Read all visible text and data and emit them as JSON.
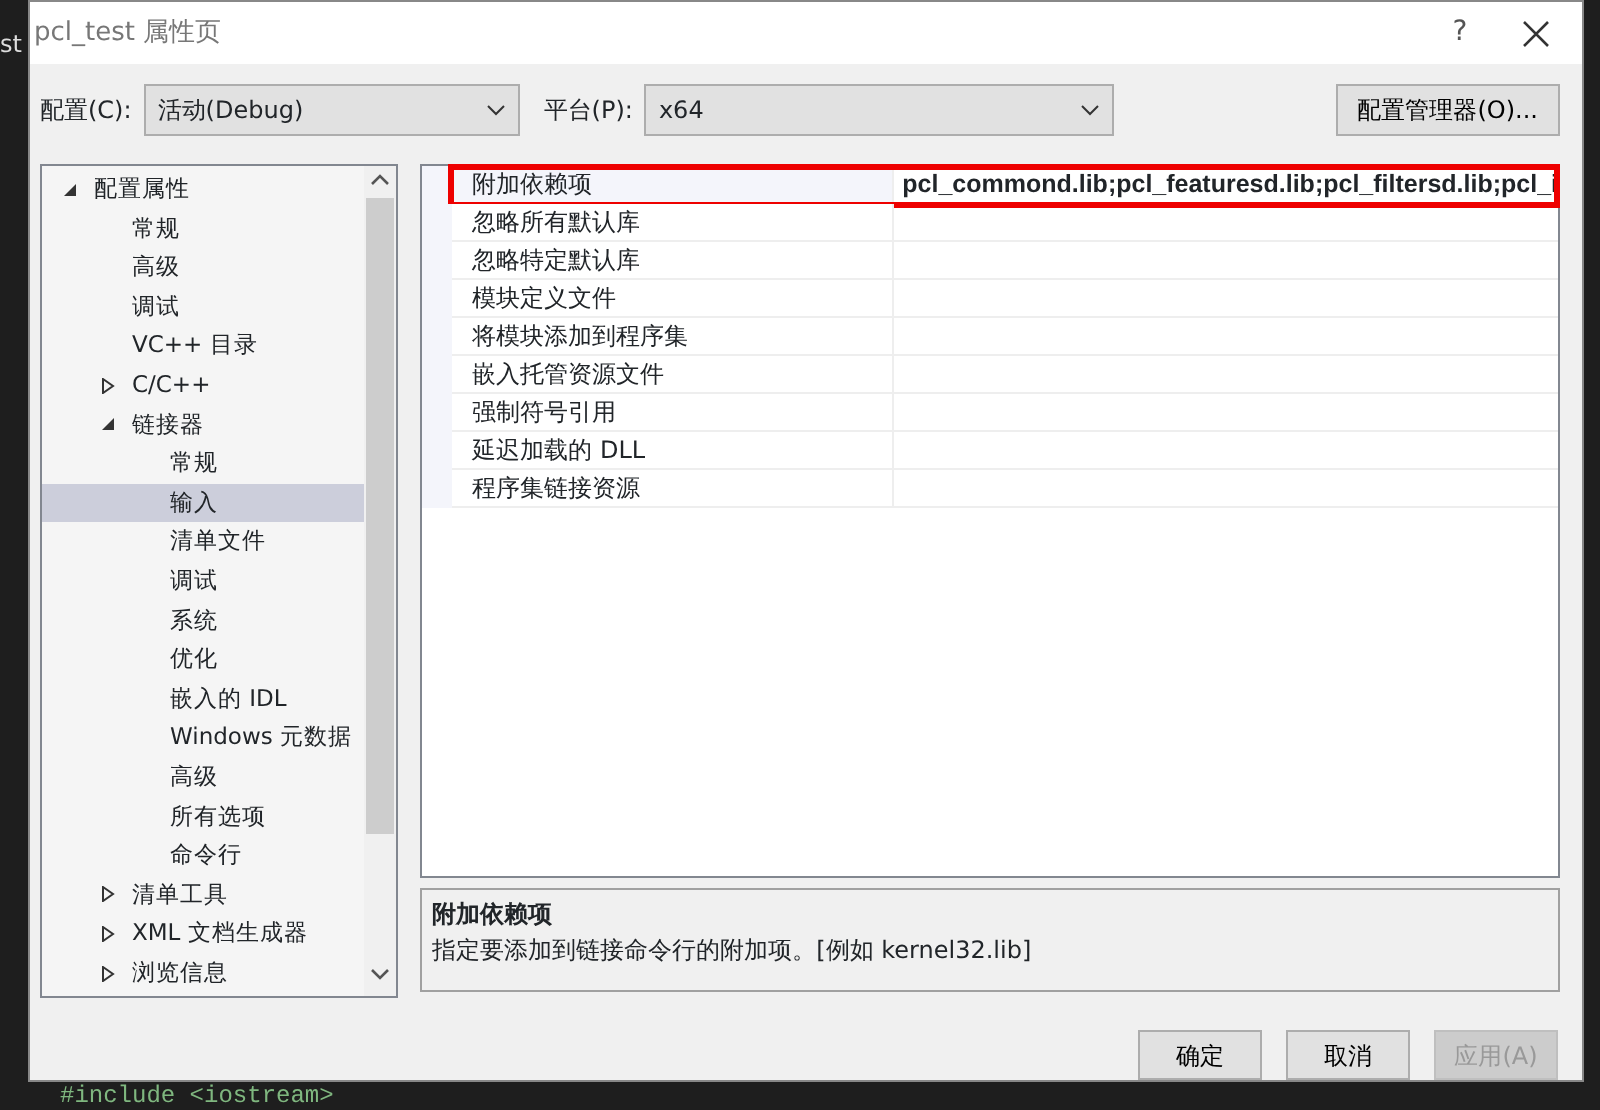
{
  "background": {
    "fragments": [
      "st",
      "#include <iostream>"
    ]
  },
  "window": {
    "title": "pcl_test 属性页",
    "help_button": "?"
  },
  "toolbar": {
    "config_label": "配置(C):",
    "config_value": "活动(Debug)",
    "platform_label": "平台(P):",
    "platform_value": "x64",
    "manager_button": "配置管理器(O)..."
  },
  "tree": [
    {
      "label": "配置属性",
      "expanded": true,
      "selected": false,
      "children": [
        {
          "label": "常规",
          "selected": false
        },
        {
          "label": "高级",
          "selected": false
        },
        {
          "label": "调试",
          "selected": false
        },
        {
          "label": "VC++ 目录",
          "selected": false
        },
        {
          "label": "C/C++",
          "expanded": false,
          "selected": false
        },
        {
          "label": "链接器",
          "expanded": true,
          "selected": false,
          "children": [
            {
              "label": "常规",
              "selected": false
            },
            {
              "label": "输入",
              "selected": true
            },
            {
              "label": "清单文件",
              "selected": false
            },
            {
              "label": "调试",
              "selected": false
            },
            {
              "label": "系统",
              "selected": false
            },
            {
              "label": "优化",
              "selected": false
            },
            {
              "label": "嵌入的 IDL",
              "selected": false
            },
            {
              "label": "Windows 元数据",
              "selected": false
            },
            {
              "label": "高级",
              "selected": false
            },
            {
              "label": "所有选项",
              "selected": false
            },
            {
              "label": "命令行",
              "selected": false
            }
          ]
        },
        {
          "label": "清单工具",
          "expanded": false,
          "selected": false
        },
        {
          "label": "XML 文档生成器",
          "expanded": false,
          "selected": false
        },
        {
          "label": "浏览信息",
          "expanded": false,
          "selected": false
        }
      ]
    }
  ],
  "grid": [
    {
      "name": "附加依赖项",
      "value": "pcl_commond.lib;pcl_featuresd.lib;pcl_filtersd.lib;pcl_i",
      "highlighted": true
    },
    {
      "name": "忽略所有默认库",
      "highlighted": false
    },
    {
      "name": "忽略特定默认库",
      "highlighted": false
    },
    {
      "name": "模块定义文件",
      "highlighted": false
    },
    {
      "name": "将模块添加到程序集",
      "highlighted": false
    },
    {
      "name": "嵌入托管资源文件",
      "highlighted": false
    },
    {
      "name": "强制符号引用",
      "highlighted": false
    },
    {
      "name": "延迟加载的 DLL",
      "highlighted": false
    },
    {
      "name": "程序集链接资源",
      "highlighted": false
    }
  ],
  "description": {
    "title": "附加依赖项",
    "text": "指定要添加到链接命令行的附加项。[例如 kernel32.lib]"
  },
  "buttons": [
    {
      "label": "确定",
      "disabled": false
    },
    {
      "label": "取消",
      "disabled": false
    },
    {
      "label": "应用(A)",
      "disabled": true
    }
  ]
}
